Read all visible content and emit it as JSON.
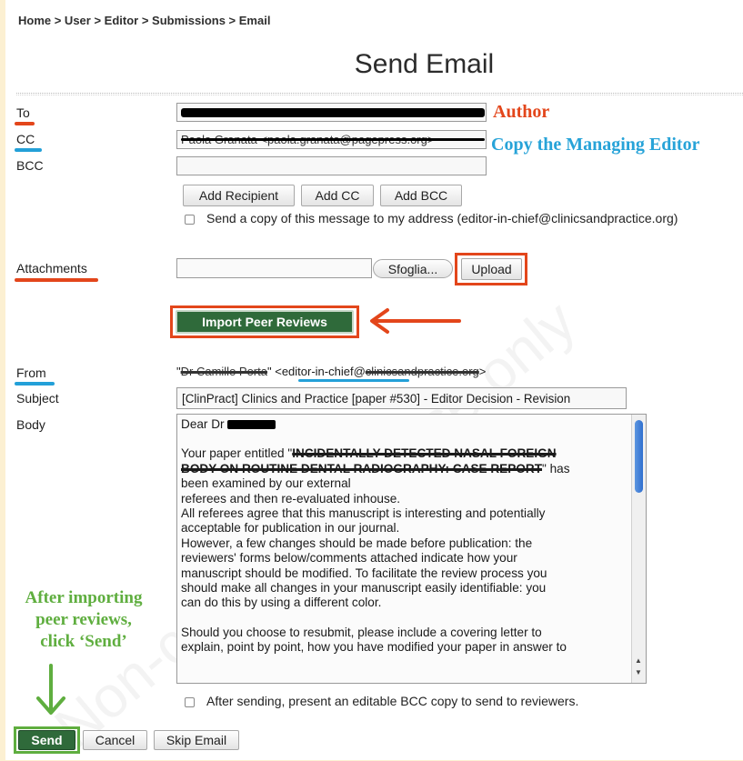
{
  "breadcrumb": "Home > User > Editor > Submissions > Email",
  "page_title": "Send Email",
  "labels": {
    "to": "To",
    "cc": "CC",
    "bcc": "BCC",
    "attachments": "Attachments",
    "from": "From",
    "subject": "Subject",
    "body": "Body"
  },
  "cc_value_redacted": "Paola Granata <paola.granata@pagepress.org>",
  "recipient_buttons": {
    "add_recipient": "Add Recipient",
    "add_cc": "Add CC",
    "add_bcc": "Add BCC"
  },
  "send_copy_label": "Send a copy of this message to my address (editor-in-chief@clinicsandpractice.org)",
  "attachments": {
    "browse_label": "Sfoglia...",
    "upload_label": "Upload"
  },
  "import_peer_reviews_label": "Import Peer Reviews",
  "from_value": {
    "name_redacted": "Dr Camillo Porta",
    "prefix": "\" <",
    "email_visible": "editor-in-chief@",
    "email_redacted": "clinicsandpractice.org",
    "suffix": ">"
  },
  "subject_value": "[ClinPract] Clinics and Practice [paper #530] - Editor Decision - Revision",
  "body": {
    "greeting": "Dear Dr ",
    "p1_a": "Your paper entitled \"",
    "p1_title_redacted_1": "INCIDENTALLY DETECTED NASAL FOREIGN",
    "p1_title_redacted_2": "BODY ON ROUTINE DENTAL RADIOGRAPHY: CASE REPORT",
    "p1_b": "\" has",
    "lines": [
      "been examined by our external",
      "referees and then re-evaluated inhouse.",
      "All referees agree that this manuscript is interesting and potentially",
      "acceptable for publication in our journal.",
      "However, a few changes should be made before publication: the",
      "reviewers' forms below/comments attached indicate how your",
      "manuscript should be modified. To facilitate the review process you",
      "should make all changes in your manuscript easily identifiable: you",
      "can do this by using a different color."
    ],
    "lines2": [
      "Should you choose to resubmit, please include a covering letter to",
      "explain, point by point, how you have modified your paper in answer to"
    ]
  },
  "bcc_copy_label": "After sending, present an editable BCC copy to send to reviewers.",
  "actions": {
    "send": "Send",
    "cancel": "Cancel",
    "skip_email": "Skip Email"
  },
  "annotations": {
    "author": "Author",
    "copy_managing_editor": "Copy the Managing Editor",
    "after_importing": [
      "After importing",
      "peer reviews,",
      "click ‘Send’"
    ]
  },
  "watermark": "Non-commercial use only",
  "colors": {
    "annotation_red": "#e3461b",
    "annotation_blue": "#23a0d8",
    "annotation_green": "#5fae3f",
    "import_button": "#2f6a3a",
    "send_button": "#2f6a3a",
    "background": "#fcf0d2"
  }
}
